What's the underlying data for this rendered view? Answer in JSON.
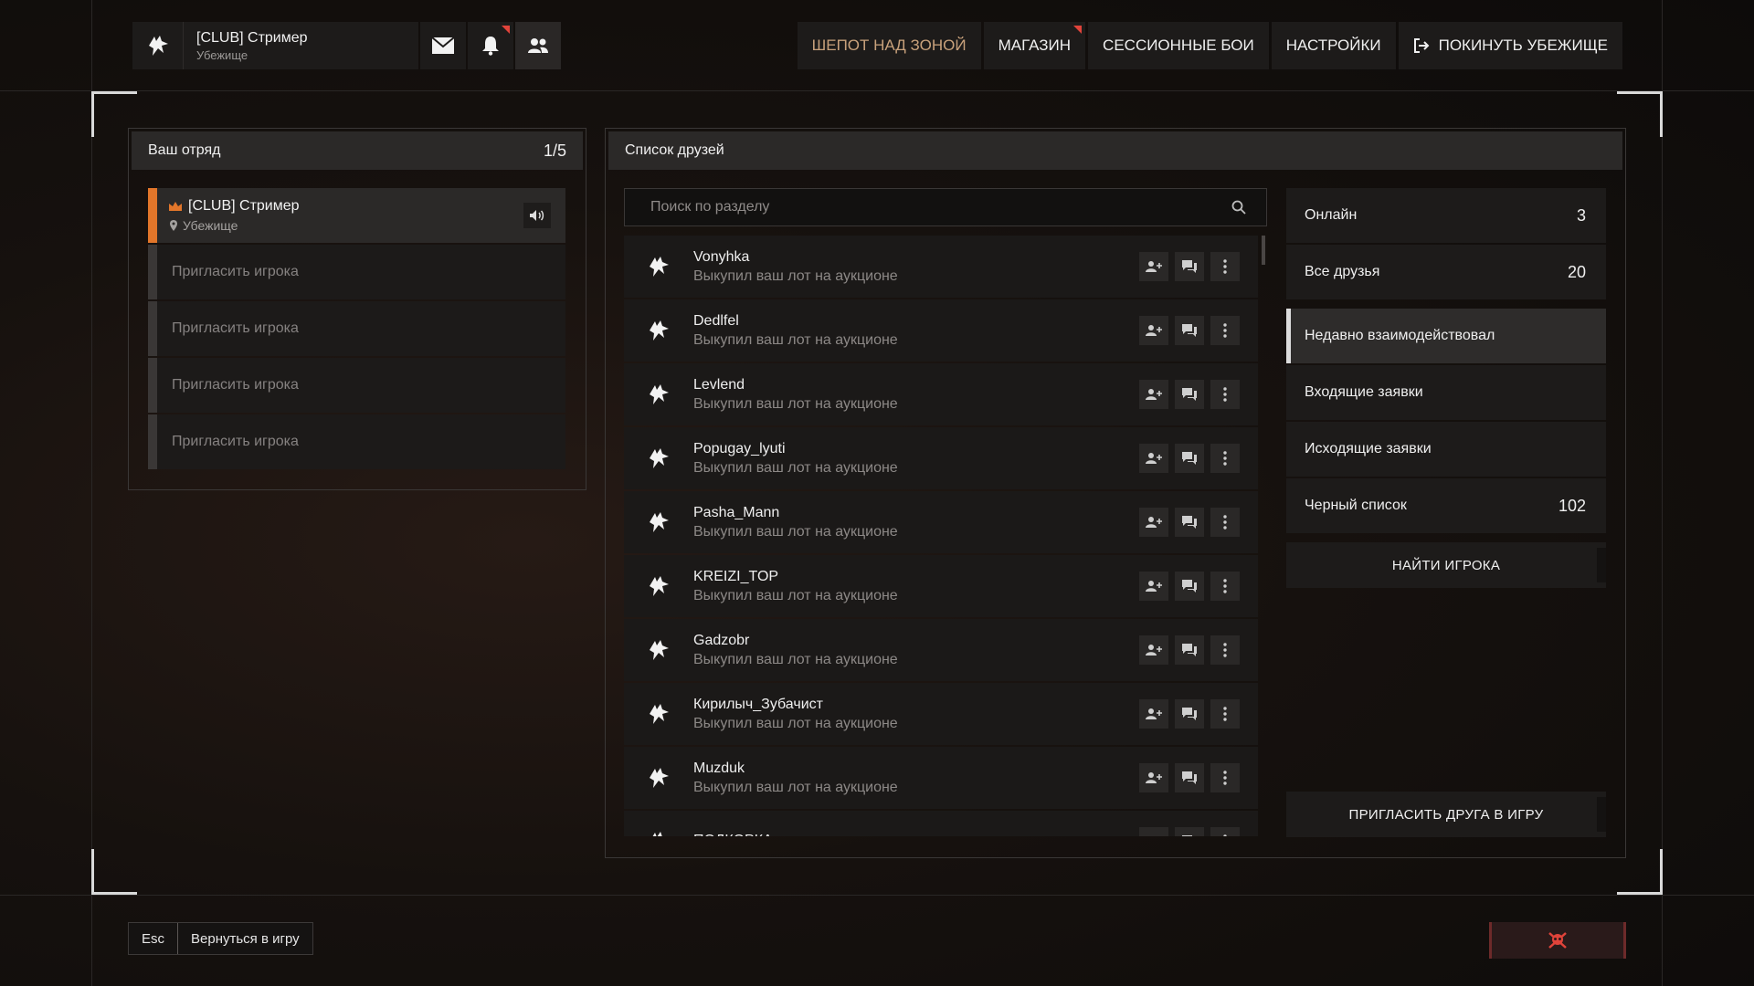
{
  "header": {
    "player_name": "[CLUB] Стример",
    "player_location": "Убежище",
    "icons": [
      "wolf-logo-icon",
      "mail-icon",
      "bell-icon",
      "friends-icon"
    ]
  },
  "nav": {
    "items": [
      {
        "label": "ШЕПОТ НАД ЗОНОЙ",
        "highlight": true,
        "badge": false
      },
      {
        "label": "МАГАЗИН",
        "highlight": false,
        "badge": true
      },
      {
        "label": "СЕССИОННЫЕ БОИ",
        "highlight": false,
        "badge": false
      },
      {
        "label": "НАСТРОЙКИ",
        "highlight": false,
        "badge": false
      },
      {
        "label": "ПОКИНУТЬ УБЕЖИЩЕ",
        "highlight": false,
        "badge": false
      }
    ]
  },
  "squad": {
    "title": "Ваш отряд",
    "count": "1/5",
    "leader": {
      "name": "[CLUB] Стример",
      "location": "Убежище"
    },
    "invite_label": "Пригласить игрока"
  },
  "friends": {
    "title": "Список друзей",
    "search_placeholder": "Поиск по разделу",
    "list": [
      {
        "name": "Vonyhka",
        "status": "Выкупил ваш лот на аукционе"
      },
      {
        "name": "Dedlfel",
        "status": "Выкупил ваш лот на аукционе"
      },
      {
        "name": "Levlend",
        "status": "Выкупил ваш лот на аукционе"
      },
      {
        "name": "Popugay_lyuti",
        "status": "Выкупил ваш лот на аукционе"
      },
      {
        "name": "Pasha_Mann",
        "status": "Выкупил ваш лот на аукционе"
      },
      {
        "name": "KREIZI_TOP",
        "status": "Выкупил ваш лот на аукционе"
      },
      {
        "name": "Gadzobr",
        "status": "Выкупил ваш лот на аукционе"
      },
      {
        "name": "Кирилыч_Зубачист",
        "status": "Выкупил ваш лот на аукционе"
      },
      {
        "name": "Muzduk",
        "status": "Выкупил ваш лот на аукционе"
      },
      {
        "name": "ПОДКОРКА",
        "status": ""
      }
    ]
  },
  "categories": [
    {
      "label": "Онлайн",
      "count": "3",
      "active": false
    },
    {
      "label": "Все друзья",
      "count": "20",
      "active": false
    },
    {
      "label": "Недавно взаимодействовал",
      "count": "",
      "active": true
    },
    {
      "label": "Входящие заявки",
      "count": "",
      "active": false
    },
    {
      "label": "Исходящие заявки",
      "count": "",
      "active": false
    },
    {
      "label": "Черный список",
      "count": "102",
      "active": false
    }
  ],
  "buttons": {
    "find_player": "НАЙТИ ИГРОКА",
    "invite_friend": "ПРИГЛАСИТЬ ДРУГА В ИГРУ"
  },
  "footer": {
    "esc_key": "Esc",
    "esc_label": "Вернуться в игру"
  },
  "colors": {
    "accent_orange": "#e2762a",
    "highlight_text": "#c8a17b",
    "badge_red": "#e0433a",
    "danger": "#e0433a"
  }
}
